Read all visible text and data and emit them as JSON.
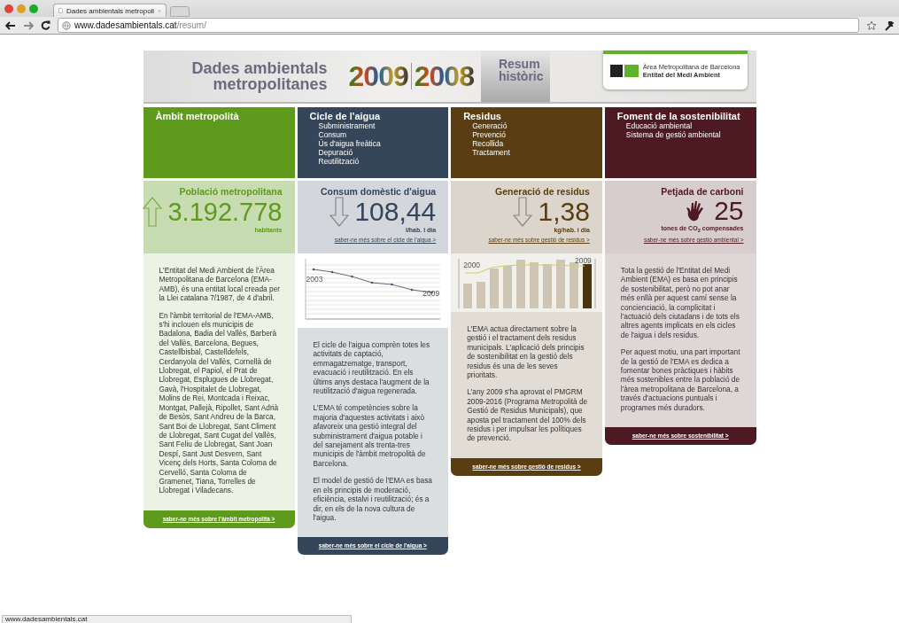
{
  "browser": {
    "tab_title": "Dades ambientals metropoli",
    "url_host": "www.dadesambientals.cat",
    "url_path": "/resum/"
  },
  "banner": {
    "title": [
      "Dades ambientals",
      "metropolitanes"
    ],
    "years": [
      "2009",
      "2008"
    ],
    "resum": [
      "Resum",
      "històric"
    ],
    "logo": [
      "Àrea Metropolitana de Barcelona",
      "Entitat del Medi Ambient"
    ]
  },
  "columns": [
    {
      "kind": "population",
      "color": "#5e9a1c",
      "title": "Àmbit metropolità",
      "stat": {
        "label": "Població metropolitana",
        "rising": true,
        "value": "3.192.778",
        "unit": "habitants"
      },
      "paragraphs": [
        "L'Entitat del Medi Ambient de l'Àrea Metropolitana de Barcelona (EMA-AMB), és una entitat local creada per la Llei catalana 7/1987, de 4 d'abril.",
        "En l'àmbit territorial de l'EMA-AMB, s'hi inclouen els municipis de Badalona, Badia del Vallès, Barberà del Vallès, Barcelona, Begues, Castellbisbal, Castelldefels, Cerdanyola del Vallès, Cornellà de Llobregat, el Papiol, el Prat de Llobregat, Esplugues de Llobregat, Gavà, l'Hospitalet de Llobregat, Molins de Rei, Montcada i Reixac, Montgat, Pallejà, Ripollet, Sant Adrià de Besòs, Sant Andreu de la Barca, Sant Boi de Llobregat, Sant Climent de Llobregat, Sant Cugat del Vallès, Sant Feliu de Llobregat, Sant Joan Despí, Sant Just Desvern, Sant Vicenç dels Horts, Santa Coloma de Cervelló, Santa Coloma de Gramenet, Tiana, Torrelles de Llobregat i Viladecans."
      ],
      "footer_link": "saber-ne més sobre l'àmbit metropolità >"
    },
    {
      "kind": "water",
      "color": "#35455a",
      "title": "Cicle de l'aigua",
      "items": [
        "Subministrament",
        "Consum",
        "Ús d'aigua freàtica",
        "Depuració",
        "Reutilització"
      ],
      "stat": {
        "label": "Consum domèstic d'aigua",
        "rising": false,
        "value": "108,44",
        "unit": "l/hab. i dia",
        "link": "saber-ne més sobre el cicle de l'aigua >"
      },
      "chart": {
        "start_label": "2003",
        "end_label": "2009"
      },
      "paragraphs": [
        "El cicle de l'aigua comprèn totes les activitats de captació, emmagatzematge, transport, evacuació i reutilització. En els últims anys destaca l'augment de la reutilització d'aigua regenerada.",
        "L'EMA té competències sobre la majoria d'aquestes activitats i això afavoreix una gestió integral del subministrament d'aigua potable i del sanejament als trenta-tres municipis de l'àmbit metropolità de Barcelona.",
        "El model de gestió de l'EMA es basa en els principis de moderació, eficiència, estalvi i reutilització; és a dir, en els de la nova cultura de l'aigua."
      ],
      "footer_link": "saber-ne més sobre el cicle de l'aigua >"
    },
    {
      "kind": "waste",
      "color": "#5a3e12",
      "title": "Residus",
      "items": [
        "Generació",
        "Prevenció",
        "Recollida",
        "Tractament"
      ],
      "stat": {
        "label": "Generació de residus",
        "rising": false,
        "value": "1,38",
        "unit": "kg/hab. i dia",
        "link": "saber-ne més sobre gestió de residus >"
      },
      "chart": {
        "start_label": "2000",
        "end_label": "2009"
      },
      "paragraphs": [
        "L'EMA actua directament sobre la gestió i el tractament dels residus municipals. L'aplicació dels principis de sostenibilitat en la gestió dels residus és una de les seves prioritats.",
        "L'any 2009 s'ha aprovat el PMGRM 2009-2016 (Programa Metropolità de Gestió de Residus Municipals), que aposta pel tractament del 100% dels residus i per impulsar les polítiques de prevenció."
      ],
      "footer_link": "saber-ne més sobre gestió de residus >"
    },
    {
      "kind": "carbon",
      "color": "#4e1a22",
      "title": "Foment de la sostenibilitat",
      "items": [
        "Educació ambiental",
        "Sistema de gestió ambiental"
      ],
      "stat": {
        "label": "Petjada de carboni",
        "value": "25",
        "unit": "tones de CO$_{2}$ compensades",
        "link": "saber-ne més sobre gestió ambiental >"
      },
      "paragraphs": [
        "Tota la gestió de l'Entitat del Medi Ambient (EMA) es basa en principis de sostenibilitat, però no pot anar més enllà per aquest camí sense la concienciació, la complicitat i l'actuació dels ciutadans i de tots els altres agents implicats en els cicles de l'aigua i dels residus.",
        "Per aquest motiu, una part important de la gestió de l'EMA es dedica a fomentar bones pràctiques i hàbits més sostenibles entre la població de l'àrea metropolitana de Barcelona, a través d'actuacions puntuals i programes més duradors."
      ],
      "footer_link": "saber-ne més sobre sostenibilitat >"
    }
  ],
  "status_bar": "www.dadesambientals.cat"
}
